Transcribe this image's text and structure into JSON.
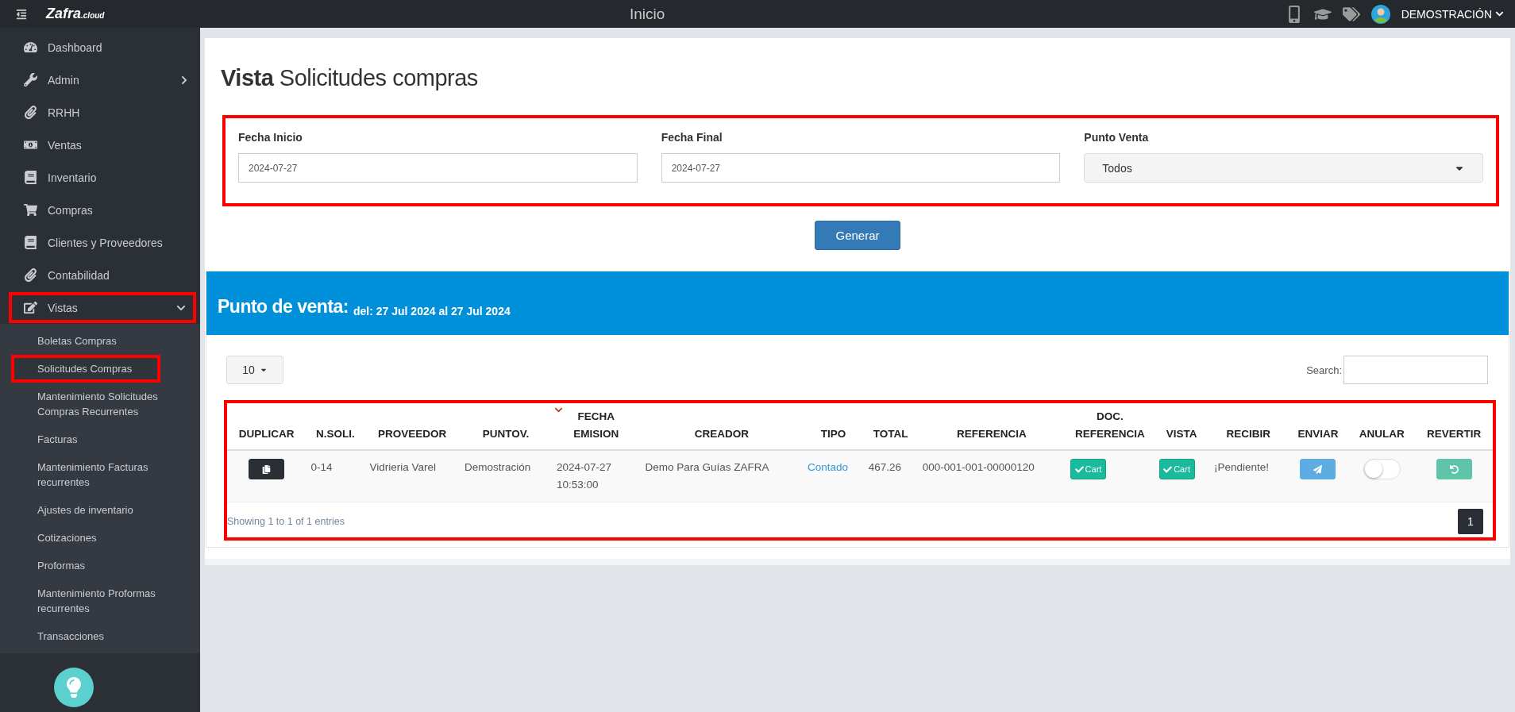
{
  "topbar": {
    "logo": "Zafra",
    "logo_suffix": ".cloud",
    "title": "Inicio",
    "user": "DEMOSTRACIÓN"
  },
  "sidebar": {
    "items": [
      {
        "label": "Dashboard"
      },
      {
        "label": "Admin",
        "expanded": false
      },
      {
        "label": "RRHH"
      },
      {
        "label": "Ventas"
      },
      {
        "label": "Inventario"
      },
      {
        "label": "Compras"
      },
      {
        "label": "Clientes y Proveedores"
      },
      {
        "label": "Contabilidad"
      },
      {
        "label": "Vistas",
        "expanded": true,
        "highlighted": true,
        "children": [
          {
            "label": "Boletas Compras",
            "selected": false,
            "highlighted": false
          },
          {
            "label": "Solicitudes Compras",
            "selected": true,
            "highlighted": true
          },
          {
            "label": "Mantenimiento Solicitudes Compras Recurrentes",
            "selected": false,
            "highlighted": false
          },
          {
            "label": "Facturas",
            "selected": false,
            "highlighted": false
          },
          {
            "label": "Mantenimiento Facturas recurrentes",
            "selected": false,
            "highlighted": false
          },
          {
            "label": "Ajustes de inventario",
            "selected": false,
            "highlighted": false
          },
          {
            "label": "Cotizaciones",
            "selected": false,
            "highlighted": false
          },
          {
            "label": "Proformas",
            "selected": false,
            "highlighted": false
          },
          {
            "label": "Mantenimiento Proformas recurrentes",
            "selected": false,
            "highlighted": false
          },
          {
            "label": "Transacciones",
            "selected": false,
            "highlighted": false
          }
        ]
      }
    ]
  },
  "page": {
    "title": "**Vista** Solicitudes compras"
  },
  "filters": {
    "highlighted": true,
    "fields": [
      {
        "kind": "input",
        "label": "Fecha Inicio",
        "value": "2024-07-27"
      },
      {
        "kind": "input",
        "label": "Fecha Final",
        "value": "2024-07-27"
      },
      {
        "kind": "select",
        "label": "Punto Venta",
        "value": "Todos"
      }
    ],
    "button": "Generar"
  },
  "banner": {
    "title": "Punto de venta:",
    "subtitle": "del: 27 Jul 2024 al 27 Jul 2024"
  },
  "table": {
    "highlighted": true,
    "page_length": "10",
    "search_label": "Search:",
    "columns": [
      {
        "label": "DUPLICAR",
        "sorted": false
      },
      {
        "label": "N.SOLI.",
        "sorted": false
      },
      {
        "label": "PROVEEDOR",
        "sorted": false
      },
      {
        "label": "PUNTOV.",
        "sorted": false
      },
      {
        "label": "FECHA EMISION",
        "sorted": true
      },
      {
        "label": "CREADOR",
        "sorted": false
      },
      {
        "label": "TIPO",
        "sorted": false
      },
      {
        "label": "TOTAL",
        "sorted": false
      },
      {
        "label": "REFERENCIA",
        "sorted": false
      },
      {
        "label": "DOC. REFERENCIA",
        "sorted": false
      },
      {
        "label": "VISTA",
        "sorted": false
      },
      {
        "label": "RECIBIR",
        "sorted": false
      },
      {
        "label": "ENVIAR",
        "sorted": false
      },
      {
        "label": "ANULAR",
        "sorted": false
      },
      {
        "label": "REVERTIR",
        "sorted": false
      }
    ],
    "rows": [
      {
        "cells": [
          {
            "kind": "copy_button"
          },
          {
            "kind": "text",
            "text": "0-14"
          },
          {
            "kind": "text",
            "text": "Vidrieria Varel"
          },
          {
            "kind": "text",
            "text": "Demostración"
          },
          {
            "kind": "text",
            "text": "2024-07-27 10:53:00"
          },
          {
            "kind": "text",
            "text": "Demo Para Guías ZAFRA"
          },
          {
            "kind": "link",
            "text": "Contado"
          },
          {
            "kind": "text",
            "text": "467.26"
          },
          {
            "kind": "text",
            "text": "000-001-001-00000120"
          },
          {
            "kind": "cart_button",
            "text": "Cart"
          },
          {
            "kind": "cart_button",
            "text": "Cart"
          },
          {
            "kind": "text",
            "text": "¡Pendiente!"
          },
          {
            "kind": "send_button"
          },
          {
            "kind": "switch",
            "on": false
          },
          {
            "kind": "revert_button"
          }
        ]
      }
    ],
    "info": "Showing 1 to 1 of 1 entries",
    "pages": [
      {
        "label": "1",
        "selected": true
      }
    ]
  }
}
